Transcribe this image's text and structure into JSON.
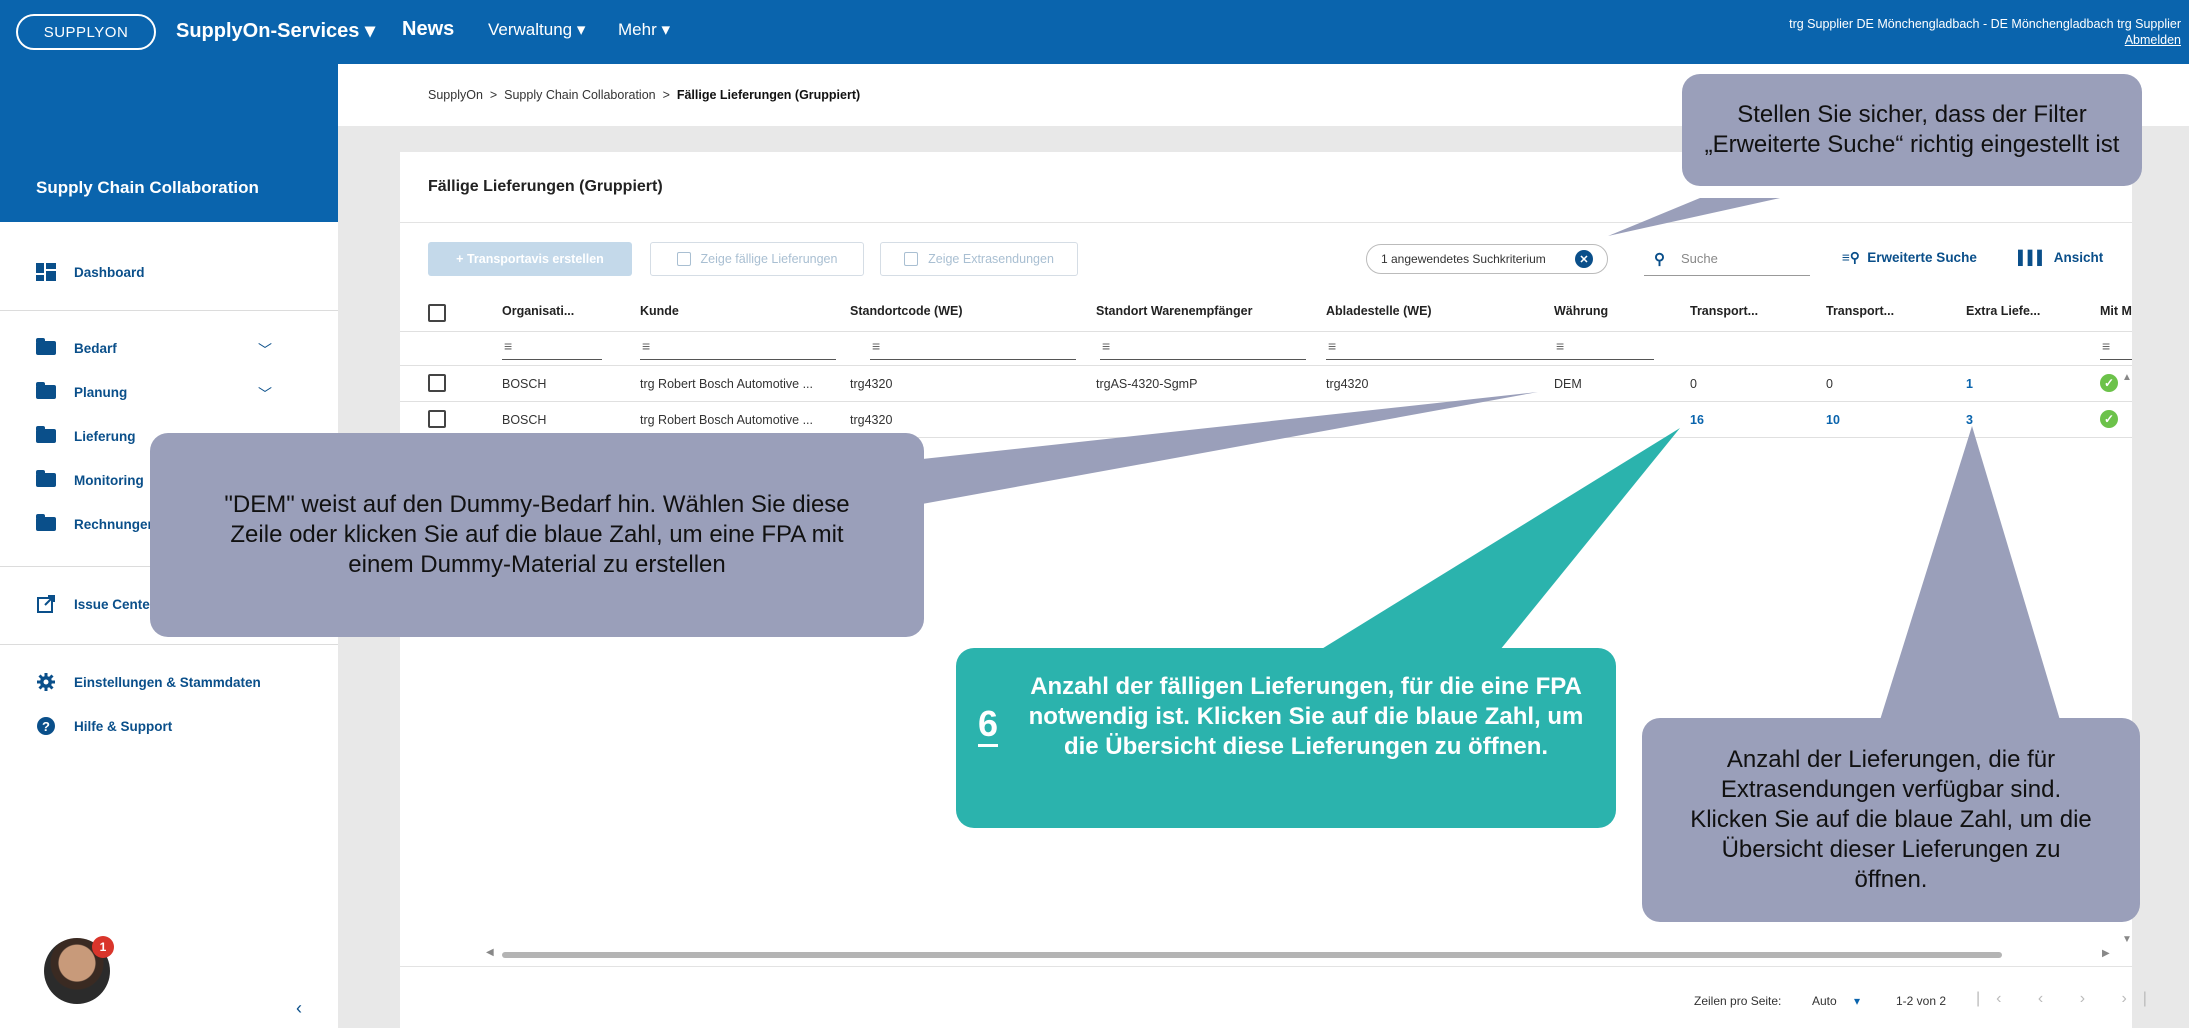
{
  "topbar": {
    "logo": "SUPPLYON",
    "services": "SupplyOn-Services ▾",
    "news": "News",
    "admin": "Verwaltung ▾",
    "more": "Mehr ▾",
    "user": "trg Supplier DE Mönchengladbach - DE Mönchengladbach trg Supplier",
    "logout": "Abmelden"
  },
  "sidebar": {
    "title": "Supply Chain Collaboration",
    "dashboard": "Dashboard",
    "items": [
      "Bedarf",
      "Planung",
      "Lieferung",
      "Monitoring",
      "Rechnungen"
    ],
    "issue_center": "Issue Center",
    "settings": "Einstellungen & Stammdaten",
    "help": "Hilfe & Support",
    "notification_count": "1",
    "collapse": "‹"
  },
  "breadcrumb": {
    "root": "SupplyOn",
    "sep": ">",
    "section": "Supply Chain Collaboration",
    "current": "Fällige Lieferungen (Gruppiert)"
  },
  "panel": {
    "title": "Fällige Lieferungen (Gruppiert)",
    "btn_create": "+ Transportavis erstellen",
    "btn_due": "Zeige fällige Lieferungen",
    "btn_extra": "Zeige Extrasendungen",
    "criteria_chip": "1 angewendetes Suchkriterium",
    "search_placeholder": "Suche",
    "advanced_search": "Erweiterte Suche",
    "view": "Ansicht"
  },
  "table": {
    "columns": [
      "Organisati...",
      "Kunde",
      "Standortcode (WE)",
      "Standort Warenempfänger",
      "Abladestelle (WE)",
      "Währung",
      "Transport...",
      "Transport...",
      "Extra Liefe...",
      "Mit Ma"
    ],
    "rows": [
      {
        "org": "BOSCH",
        "kunde": "trg Robert Bosch Automotive ...",
        "standortcode": "trg4320",
        "standort": "trgAS-4320-SgmP",
        "ablade": "trg4320",
        "waehrung": "DEM",
        "t1": "0",
        "t2": "0",
        "extra": "1"
      },
      {
        "org": "BOSCH",
        "kunde": "trg Robert Bosch Automotive ...",
        "standortcode": "trg4320",
        "standort": "",
        "ablade": "",
        "waehrung": "",
        "t1": "16",
        "t2": "10",
        "extra": "3"
      }
    ]
  },
  "pager": {
    "rows_label": "Zeilen pro Seite:",
    "rows_value": "Auto",
    "range": "1-2 von 2"
  },
  "callouts": {
    "filter": "Stellen Sie sicher, dass der Filter „Erweiterte Suche“ richtig eingestellt ist",
    "dem": "\"DEM\" weist auf den Dummy-Bedarf hin. Wählen Sie diese Zeile oder klicken Sie auf die blaue Zahl, um eine FPA mit einem Dummy-Material zu erstellen",
    "step_number": "6",
    "due": "Anzahl der fälligen Lieferungen, für die eine FPA notwendig ist. Klicken Sie auf die blaue Zahl, um die Übersicht diese Lieferungen zu öffnen.",
    "extra": "Anzahl der Lieferungen, die für Extrasendungen verfügbar sind. Klicken Sie auf die blaue Zahl, um die Übersicht dieser Lieferungen zu öffnen."
  },
  "colors": {
    "brand_blue": "#0a64ad",
    "callout_gray": "#9a9fba",
    "callout_teal": "#2bb3ad",
    "ok_green": "#6cc24a"
  }
}
